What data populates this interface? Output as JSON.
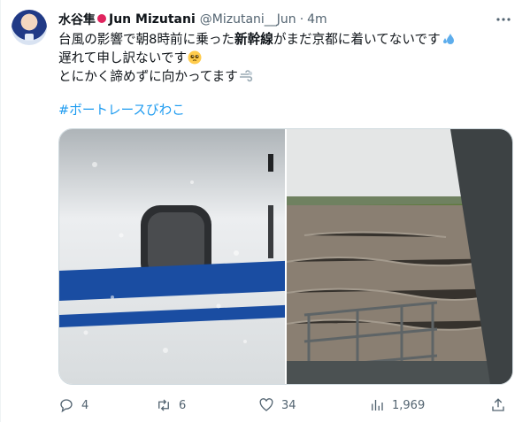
{
  "tweet": {
    "author": {
      "name": "水谷隼",
      "name_en": "Jun Mizutani",
      "handle": "@Mizutani__Jun",
      "separator": "·",
      "time": "4m"
    },
    "text": {
      "line1_a": "台風の影響で朝8時前に乗った",
      "line1_bold": "新幹線",
      "line1_b": "がまだ京都に着いてないです",
      "line2": "遅れて申し訳ないです",
      "line3": "とにかく諦めずに向かってます",
      "hashtag": "#ボートレースびわこ"
    },
    "stats": {
      "replies": "4",
      "retweets": "6",
      "likes": "34",
      "views": "1,969"
    },
    "icons": {
      "more": "more-icon",
      "reply": "reply-icon",
      "retweet": "retweet-icon",
      "like": "heart-icon",
      "views": "views-icon",
      "share": "share-icon"
    },
    "colors": {
      "link": "#1d9bf0",
      "secondary": "#536471",
      "pin": "#e0245e"
    }
  }
}
